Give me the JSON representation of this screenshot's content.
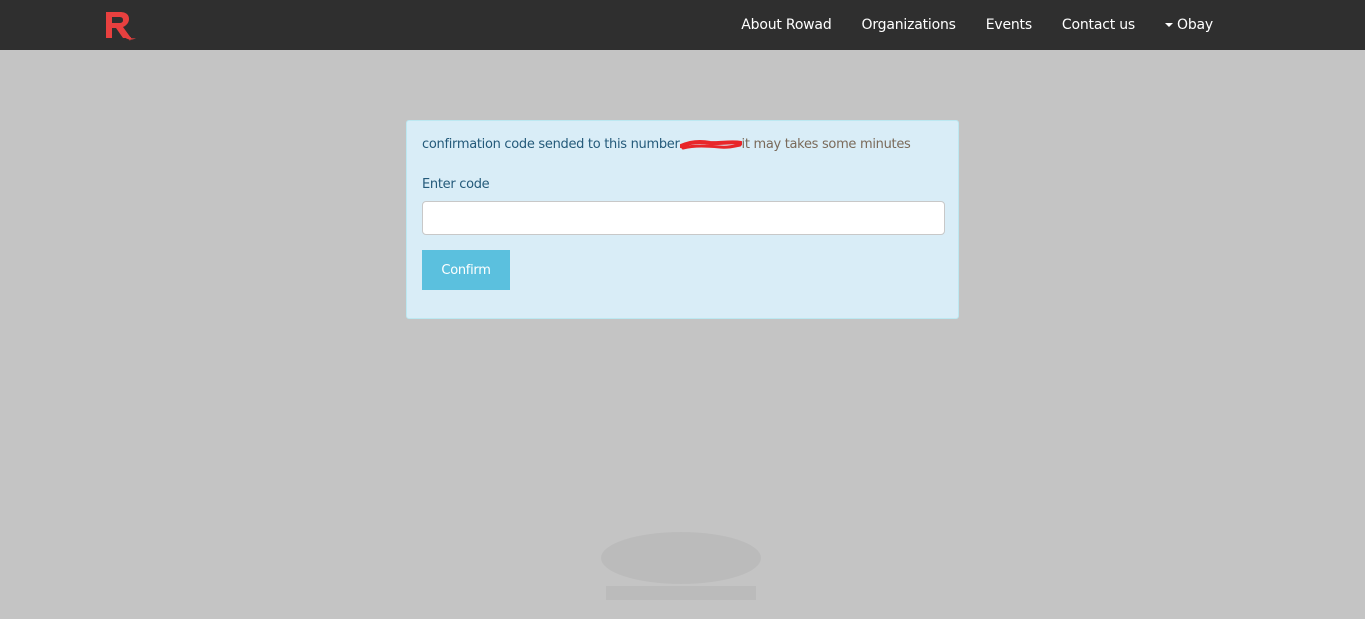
{
  "navbar": {
    "logo_letter": "R",
    "brand_color": "#e8403f",
    "background_color": "#2f2f2f",
    "links": [
      {
        "label": "About Rowad"
      },
      {
        "label": "Organizations"
      },
      {
        "label": "Events"
      },
      {
        "label": "Contact us"
      }
    ],
    "user_menu": {
      "label": "Obay",
      "icon": "caret-down-icon"
    }
  },
  "confirmation": {
    "message_main": "confirmation code sended to this number",
    "message_note": "it may takes some minutes",
    "redaction_color": "#e8262a",
    "field_label": "Enter code",
    "code_value": "",
    "confirm_label": "Confirm",
    "panel_color": "#d9edf7",
    "button_color": "#5bc0de"
  }
}
